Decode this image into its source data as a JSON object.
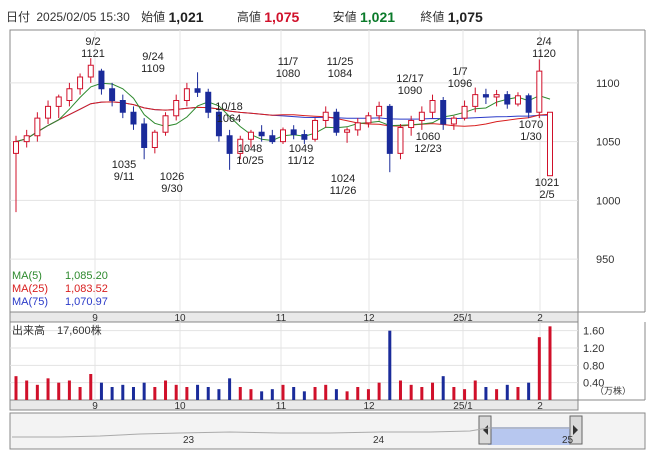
{
  "header": {
    "date_label": "日付",
    "datetime": "2025/02/05 15:30",
    "open_label": "始値",
    "open": "1,021",
    "high_label": "高値",
    "high": "1,075",
    "low_label": "安値",
    "low": "1,021",
    "close_label": "終値",
    "close": "1,075"
  },
  "legend": {
    "ma5_label": "MA(5)",
    "ma5_value": "1,085.20",
    "ma25_label": "MA(25)",
    "ma25_value": "1,083.52",
    "ma75_label": "MA(75)",
    "ma75_value": "1,070.97"
  },
  "volume": {
    "title": "出来高",
    "value": "17,600株",
    "unit": "（万株）"
  },
  "colors": {
    "up": "#d0102a",
    "down": "#1a2b9a",
    "ma5": "#2e8a2e",
    "ma25": "#d81e1e",
    "ma75": "#2a3ac8",
    "volume_up": "#d0102a",
    "volume_down": "#1a2b9a",
    "navigator_fill": "#b7c7ef"
  },
  "chart_data": {
    "type": "candlestick",
    "price_axis": {
      "ticks": [
        950,
        1000,
        1050,
        1100
      ],
      "ylim": [
        905,
        1145
      ]
    },
    "x_ticks": [
      "9",
      "10",
      "11",
      "12",
      "25/1",
      "2"
    ],
    "annotations": [
      {
        "value": "9/2",
        "price": "1121"
      },
      {
        "value": "9/24",
        "price": "1109"
      },
      {
        "value": "9/11",
        "price": "1035"
      },
      {
        "value": "9/30",
        "price": "1026"
      },
      {
        "value": "10/18",
        "price": "1064"
      },
      {
        "value": "10/25",
        "price": "1048"
      },
      {
        "value": "11/7",
        "price": "1080"
      },
      {
        "value": "11/12",
        "price": "1049"
      },
      {
        "value": "11/25",
        "price": "1084"
      },
      {
        "value": "11/26",
        "price": "1024"
      },
      {
        "value": "12/17",
        "price": "1090"
      },
      {
        "value": "12/23",
        "price": "1060"
      },
      {
        "value": "1/7",
        "price": "1096"
      },
      {
        "value": "1/30",
        "price": "1070"
      },
      {
        "value": "2/4",
        "price": "1120"
      },
      {
        "value": "2/5",
        "price": "1021"
      }
    ],
    "candles_ohlc": [
      [
        1040,
        1055,
        990,
        1050
      ],
      [
        1050,
        1060,
        1045,
        1055
      ],
      [
        1055,
        1075,
        1050,
        1070
      ],
      [
        1070,
        1085,
        1065,
        1080
      ],
      [
        1080,
        1090,
        1070,
        1088
      ],
      [
        1085,
        1100,
        1080,
        1095
      ],
      [
        1095,
        1108,
        1090,
        1105
      ],
      [
        1105,
        1121,
        1100,
        1115
      ],
      [
        1110,
        1112,
        1090,
        1095
      ],
      [
        1095,
        1100,
        1080,
        1085
      ],
      [
        1085,
        1090,
        1070,
        1075
      ],
      [
        1075,
        1080,
        1060,
        1065
      ],
      [
        1065,
        1070,
        1035,
        1045
      ],
      [
        1045,
        1060,
        1040,
        1058
      ],
      [
        1058,
        1075,
        1055,
        1072
      ],
      [
        1072,
        1090,
        1068,
        1085
      ],
      [
        1085,
        1100,
        1080,
        1095
      ],
      [
        1095,
        1109,
        1088,
        1092
      ],
      [
        1092,
        1095,
        1070,
        1075
      ],
      [
        1075,
        1078,
        1050,
        1055
      ],
      [
        1055,
        1060,
        1026,
        1040
      ],
      [
        1040,
        1055,
        1035,
        1052
      ],
      [
        1052,
        1060,
        1045,
        1058
      ],
      [
        1058,
        1064,
        1050,
        1055
      ],
      [
        1055,
        1060,
        1048,
        1050
      ],
      [
        1050,
        1062,
        1048,
        1060
      ],
      [
        1060,
        1064,
        1052,
        1056
      ],
      [
        1056,
        1060,
        1048,
        1052
      ],
      [
        1052,
        1070,
        1050,
        1068
      ],
      [
        1068,
        1080,
        1062,
        1075
      ],
      [
        1075,
        1078,
        1055,
        1058
      ],
      [
        1058,
        1062,
        1049,
        1060
      ],
      [
        1060,
        1070,
        1055,
        1066
      ],
      [
        1066,
        1075,
        1062,
        1072
      ],
      [
        1072,
        1084,
        1068,
        1080
      ],
      [
        1080,
        1082,
        1024,
        1040
      ],
      [
        1040,
        1065,
        1035,
        1062
      ],
      [
        1062,
        1072,
        1055,
        1068
      ],
      [
        1068,
        1080,
        1060,
        1075
      ],
      [
        1075,
        1090,
        1070,
        1085
      ],
      [
        1085,
        1088,
        1060,
        1065
      ],
      [
        1065,
        1072,
        1060,
        1070
      ],
      [
        1070,
        1085,
        1068,
        1080
      ],
      [
        1080,
        1096,
        1075,
        1090
      ],
      [
        1090,
        1095,
        1082,
        1088
      ],
      [
        1088,
        1094,
        1080,
        1090
      ],
      [
        1090,
        1093,
        1078,
        1082
      ],
      [
        1082,
        1092,
        1080,
        1089
      ],
      [
        1089,
        1091,
        1070,
        1075
      ],
      [
        1075,
        1120,
        1070,
        1110
      ],
      [
        1021,
        1075,
        1021,
        1075
      ]
    ],
    "volume_axis": {
      "ticks": [
        "0.40",
        "0.80",
        "1.20",
        "1.60"
      ],
      "ylim": [
        0,
        1.8
      ]
    },
    "volume_values": [
      0.55,
      0.45,
      0.35,
      0.5,
      0.4,
      0.45,
      0.3,
      0.6,
      0.4,
      0.3,
      0.35,
      0.3,
      0.4,
      0.3,
      0.45,
      0.35,
      0.3,
      0.35,
      0.3,
      0.25,
      0.5,
      0.3,
      0.25,
      0.2,
      0.25,
      0.35,
      0.3,
      0.2,
      0.3,
      0.35,
      0.25,
      0.2,
      0.3,
      0.25,
      0.4,
      1.6,
      0.45,
      0.35,
      0.3,
      0.4,
      0.55,
      0.3,
      0.25,
      0.45,
      0.3,
      0.25,
      0.35,
      0.3,
      0.4,
      1.45,
      1.7
    ],
    "navigator": {
      "labels": [
        "23",
        "24",
        "25"
      ]
    }
  }
}
